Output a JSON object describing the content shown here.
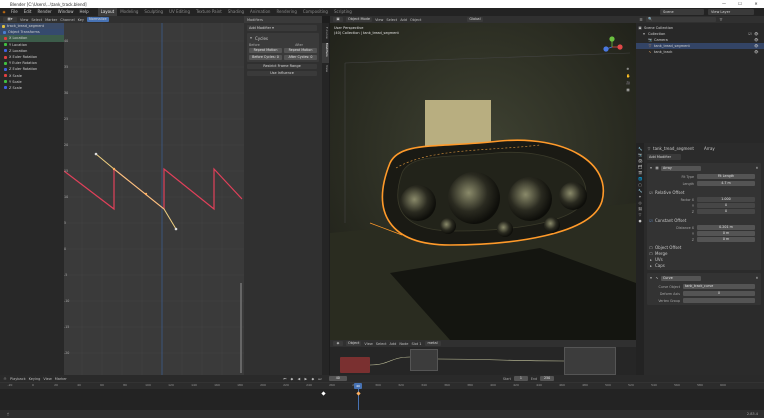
{
  "window": {
    "title": "Blender [C:\\Users\\...\\tank_track.blend]",
    "controls": [
      "—",
      "☐",
      "✕"
    ]
  },
  "menubar": {
    "items": [
      "File",
      "Edit",
      "Render",
      "Window",
      "Help"
    ],
    "workspaces": [
      "Layout",
      "Modeling",
      "Sculpting",
      "UV Editing",
      "Texture Paint",
      "Shading",
      "Animation",
      "Rendering",
      "Compositing",
      "Scripting"
    ],
    "active_workspace": "Layout",
    "scene_label": "Scene",
    "view_layer_label": "View Layer"
  },
  "graph_editor": {
    "header": [
      "View",
      "Select",
      "Marker",
      "Channel",
      "Key",
      "Normalize"
    ],
    "mode": "Graph Editor",
    "channels": [
      {
        "label": "track_tread_segment",
        "color": "#e0c040"
      },
      {
        "label": "Object Transforms",
        "color": "#4a7fd0"
      },
      {
        "label": "X Location",
        "color": "#e04040"
      },
      {
        "label": "Y Location",
        "color": "#40c040"
      },
      {
        "label": "Z Location",
        "color": "#4060e0"
      },
      {
        "label": "X Euler Rotation",
        "color": "#e04040"
      },
      {
        "label": "Y Euler Rotation",
        "color": "#40c040"
      },
      {
        "label": "Z Euler Rotation",
        "color": "#4060e0"
      },
      {
        "label": "X Scale",
        "color": "#e04040"
      },
      {
        "label": "Y Scale",
        "color": "#40c040"
      },
      {
        "label": "Z Scale",
        "color": "#4060e0"
      }
    ],
    "y_ticks": [
      "40",
      "35",
      "30",
      "25",
      "20",
      "15",
      "10",
      "5",
      "0",
      "-5",
      "-10",
      "-15",
      "-20"
    ]
  },
  "modifiers_panel": {
    "title": "Modifiers",
    "add_modifier": "Add Modifier",
    "modifier_name": "Cycles",
    "before_label": "Before",
    "after_label": "After",
    "before_mode": "Repeat Motion",
    "after_mode": "Repeat Motion",
    "before_cycles": "Before Cycles: 0",
    "after_cycles": "After Cycles: 0",
    "restrict_range": "Restrict Frame Range",
    "influence": "Use Influence",
    "tabs": [
      "F-Curve",
      "Modifiers",
      "View"
    ]
  },
  "viewport": {
    "mode": "Object Mode",
    "menus": [
      "View",
      "Select",
      "Add",
      "Object"
    ],
    "shading": "Global",
    "overlay_title": "User Perspective",
    "overlay_sub": "(40) Collection | tank_tread_segment"
  },
  "outliner": {
    "header": "Scene Collection",
    "rows": [
      {
        "label": "Scene Collection",
        "indent": 0
      },
      {
        "label": "Collection",
        "indent": 1
      },
      {
        "label": "Camera",
        "indent": 2
      },
      {
        "label": "tank_tread_segment",
        "indent": 2
      },
      {
        "label": "tank_track",
        "indent": 2
      }
    ]
  },
  "properties": {
    "object_name": "tank_tread_segment",
    "modifier_name": "Array",
    "modifier_title": "Add Modifier",
    "fit_type_label": "Fit Type",
    "fit_type_value": "Fit Length",
    "length_label": "Length",
    "length_value": "4.7 m",
    "relative_offset": "Relative Offset",
    "factor_x": "Factor X",
    "factor_x_val": "1.000",
    "factor_y": "Y",
    "factor_y_val": "0",
    "factor_z": "Z",
    "factor_z_val": "0",
    "constant_offset": "Constant Offset",
    "distance_x": "Distance X",
    "distance_x_val": "0.201 m",
    "distance_y_val": "0 m",
    "distance_z_val": "0 m",
    "object_offset": "Object Offset",
    "merge": "Merge",
    "uvs": "UVs",
    "caps": "Caps",
    "curve_modifier": "Curve",
    "curve_object_label": "Curve Object",
    "curve_object_value": "tank_track_curve",
    "deform_axis_label": "Deform Axis",
    "deform_axis_value": "X",
    "vertex_group_label": "Vertex Group"
  },
  "shader_editor": {
    "mode": "Object",
    "menus": [
      "View",
      "Select",
      "Add",
      "Node"
    ],
    "slot": "Slot 1",
    "material": "metal"
  },
  "timeline": {
    "menus": [
      "Playback",
      "Keying",
      "View",
      "Marker"
    ],
    "current_frame": "40",
    "start_label": "Start",
    "start": "1",
    "end_label": "End",
    "end": "250",
    "ticks": [
      "-20",
      "0",
      "20",
      "40",
      "60",
      "80",
      "100",
      "120",
      "140",
      "160",
      "180",
      "200",
      "220",
      "240",
      "260",
      "280",
      "300",
      "320",
      "340",
      "360",
      "380",
      "400",
      "420",
      "440",
      "460",
      "480",
      "500",
      "520",
      "540",
      "560",
      "580",
      "600"
    ],
    "status": "2.83.4"
  },
  "colors": {
    "accent": "#4772b3",
    "curve": "#e0405a",
    "active_curve": "#e0c040",
    "outline": "#ff9a2a"
  }
}
